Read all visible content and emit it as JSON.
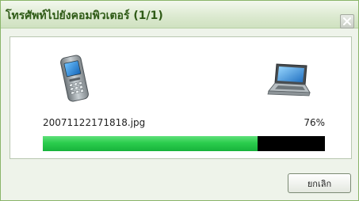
{
  "window": {
    "title": "โทรศัพท์ไปยังคอมพิวเตอร์ (1/1)"
  },
  "transfer": {
    "filename": "20071122171818.jpg",
    "percent_label": "76%",
    "progress": 0.76,
    "source_icon": "mobile-phone-icon",
    "destination_icon": "laptop-icon"
  },
  "buttons": {
    "cancel_label": "ยกเลิก"
  },
  "colors": {
    "progress_fill": "#2bcd4d",
    "progress_track": "#000000",
    "title_text": "#2e5a16"
  }
}
